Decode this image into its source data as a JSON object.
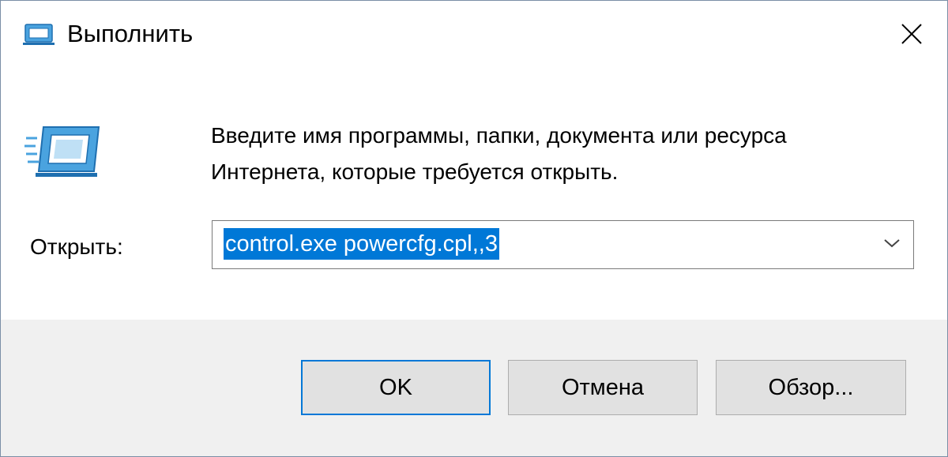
{
  "window": {
    "title": "Выполнить",
    "title_icon": "run-icon",
    "close_icon": "close-icon"
  },
  "content": {
    "icon": "run-icon",
    "description_line1": "Введите имя программы, папки, документа или ресурса",
    "description_line2": "Интернета, которые требуется открыть.",
    "open_label": "Открыть:",
    "open_value": "control.exe powercfg.cpl,,3",
    "dropdown_icon": "chevron-down-icon"
  },
  "buttons": {
    "ok": "OK",
    "cancel": "Отмена",
    "browse": "Обзор..."
  },
  "colors": {
    "selection": "#0078d7",
    "footer_bg": "#f0f0f0",
    "button_bg": "#e1e1e1",
    "default_button_border": "#0078d7"
  }
}
